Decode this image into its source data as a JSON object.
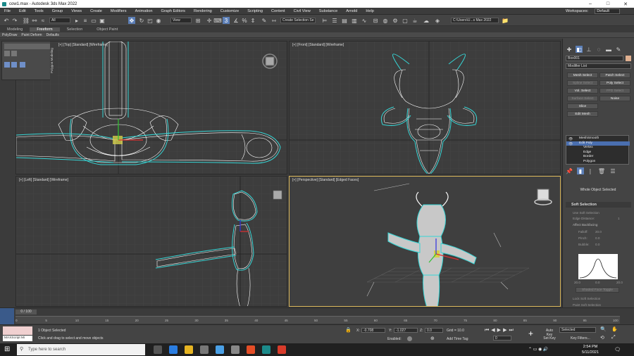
{
  "window": {
    "title": "cow1.max - Autodesk 3ds Max 2022",
    "minimize": "–",
    "maximize": "□",
    "close": "✕"
  },
  "menu": [
    "File",
    "Edit",
    "Tools",
    "Group",
    "Views",
    "Create",
    "Modifiers",
    "Animation",
    "Graph Editors",
    "Rendering",
    "Customize",
    "Scripting",
    "Content",
    "Civil View",
    "Substance",
    "Arnold",
    "Help"
  ],
  "workspace": {
    "label": "Workspaces:",
    "value": "Default"
  },
  "toolbar": {
    "filter": "All",
    "coord": "View",
    "selection_set": "Create Selection Se",
    "path": "C:\\Users\\U...s Max 2022"
  },
  "ribbon_tabs": [
    "Modeling",
    "Freeform",
    "Selection",
    "Object Paint"
  ],
  "ribbon_active": "Freeform",
  "subtabs": [
    "PolyDraw",
    "Paint Deform",
    "Defaults"
  ],
  "poly_panel": {
    "label": "Polygon Modeling"
  },
  "viewports": {
    "top": "[+] [Top] [Standard] [Wireframe]",
    "front": "[+] [Front] [Standard] [Wireframe]",
    "left": "[+] [Left] [Standard] [Wireframe]",
    "persp": "[+] [Perspective] [Standard] [Edged Faces]"
  },
  "command_panel": {
    "object_name": "Box001",
    "modifier_list": "Modifier List",
    "buttons": [
      [
        "Mesh Select",
        "Patch Select"
      ],
      [
        "Spline Select",
        "Poly Select"
      ],
      [
        "Vol. Select",
        "FFD Select"
      ],
      [
        "Surface Select",
        "Noise"
      ],
      [
        "Slice",
        ""
      ],
      [
        "Edit Mesh",
        ""
      ]
    ],
    "stack": [
      "MeshSmooth",
      "Edit Poly",
      "Vertex",
      "Edge",
      "Border",
      "Polygon"
    ],
    "stack_selected": "Edit Poly",
    "whole_object": "Whole Object Selected",
    "soft_selection": "Soft Selection",
    "use_soft": "Use Soft Selection",
    "edge_distance": "Edge Distance:",
    "edge_distance_val": "1",
    "affect_backfacing": "Affect Backfacing",
    "falloff": "Falloff:",
    "falloff_val": "20.0",
    "pinch": "Pinch:",
    "pinch_val": "0.0",
    "bubble": "Bubble:",
    "bubble_val": "0.0",
    "curve_left": "20.0",
    "curve_mid": "0.0",
    "curve_right": "20.0",
    "shaded_face": "Shaded Face Toggle",
    "lock_soft": "Lock Soft Selection",
    "paint_soft": "Paint Soft Selection"
  },
  "timeline": {
    "frame_label": "0 / 100",
    "ticks": [
      "0",
      "5",
      "10",
      "15",
      "20",
      "25",
      "30",
      "35",
      "40",
      "45",
      "50",
      "55",
      "60",
      "65",
      "70",
      "75",
      "80",
      "85",
      "90",
      "95",
      "100"
    ]
  },
  "status": {
    "maxscript": "MAXScript Mi",
    "selected": "1 Object Selected",
    "hint": "Click and drag to select and move objects",
    "x_label": "X:",
    "x": "-0.708",
    "y_label": "Y:",
    "y": "-1.027",
    "z_label": "Z:",
    "z": "0.0",
    "grid": "Grid = 10.0",
    "enabled": "Enabled:",
    "add_time_tag": "Add Time Tag",
    "auto_key": "Auto Key",
    "set_key": "Set Key",
    "selected_dd": "Selected",
    "key_filters": "Key Filters...",
    "frame": "0"
  },
  "taskbar": {
    "search": "Type here to search",
    "time": "2:54 PM",
    "date": "5/11/2021"
  },
  "colors": {
    "accent": "#5c7fb7",
    "wire": "#ffffff",
    "selection": "#36d6d6",
    "active_border": "#d9b65a"
  }
}
